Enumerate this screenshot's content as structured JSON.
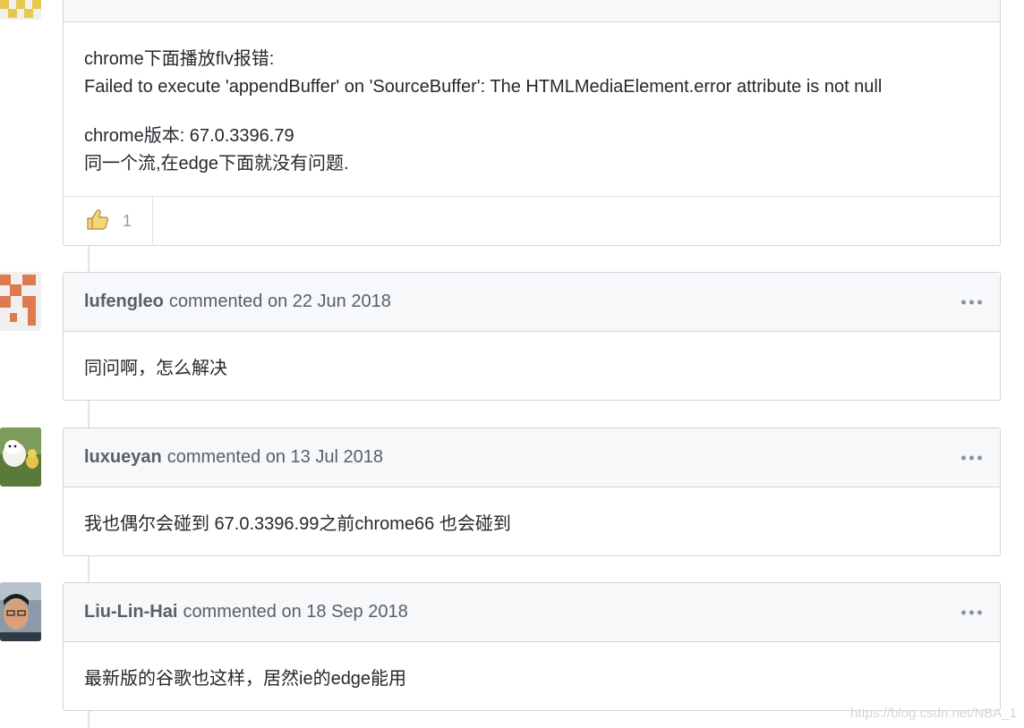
{
  "first_comment": {
    "body_lines": [
      "chrome下面播放flv报错:",
      "Failed to execute 'appendBuffer' on 'SourceBuffer': The HTMLMediaElement.error attribute is not null",
      "chrome版本: 67.0.3396.79",
      "同一个流,在edge下面就没有问题."
    ],
    "reaction_icon": "thumbs-up-icon",
    "reaction_count": "1"
  },
  "comments": [
    {
      "author": "lufengleo",
      "action": "commented on 22 Jun 2018",
      "body": "同问啊，怎么解决",
      "avatar": "identicon-orange"
    },
    {
      "author": "luxueyan",
      "action": "commented on 13 Jul 2018",
      "body": "我也偶尔会碰到 67.0.3396.99之前chrome66 也会碰到",
      "avatar": "puppy-photo"
    },
    {
      "author": "Liu-Lin-Hai",
      "action": "commented on 18 Sep 2018",
      "body": "最新版的谷歌也这样，居然ie的edge能用",
      "avatar": "person-photo"
    }
  ],
  "watermark": "https://blog.csdn.net/NBA_1",
  "colors": {
    "border": "#d1d5da",
    "header_bg": "#f6f8fa",
    "identicon": "#de7a4e"
  }
}
